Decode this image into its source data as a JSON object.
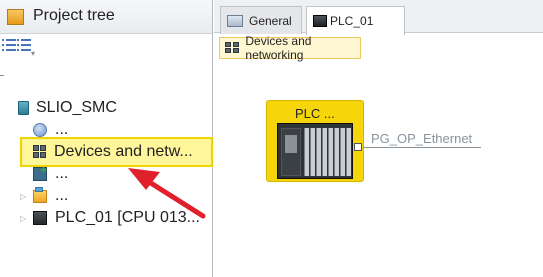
{
  "project_tree": {
    "title": "Project tree",
    "items": [
      {
        "label": "SLIO_SMC",
        "icon": "project-icon"
      },
      {
        "label": "...",
        "icon": "info-icon"
      },
      {
        "label": "Devices and netw...",
        "icon": "devices-networks-icon"
      },
      {
        "label": "...",
        "icon": "add-device-icon"
      },
      {
        "label": "...",
        "icon": "folder-icon"
      },
      {
        "label": "PLC_01 [CPU 013...",
        "icon": "plc-icon"
      }
    ]
  },
  "editor": {
    "tabs": [
      {
        "label": "General",
        "icon": "general-icon"
      },
      {
        "label": "PLC_01",
        "icon": "plc-icon"
      }
    ],
    "subtab": "Devices and networking",
    "plc": {
      "label": "PLC ..."
    },
    "network": {
      "label": "PG_OP_Ethernet"
    }
  },
  "colors": {
    "selection": "#fff59a",
    "selection_border": "#f0d400",
    "plc_box": "#f7d50b",
    "arrow": "#e0202a"
  }
}
